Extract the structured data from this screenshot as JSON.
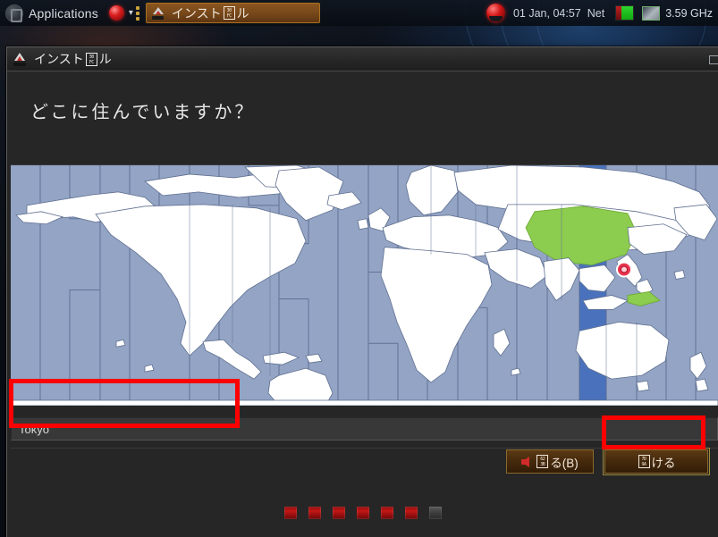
{
  "panel": {
    "applications_label": "Applications",
    "menu_logo_icon": "distro-logo-icon",
    "orb_icon": "red-orb-icon",
    "chevron_icon": "chevron-down-icon",
    "task_button": {
      "icon": "installer-icon",
      "label_prefix": "インスト",
      "tofu_top": "30",
      "tofu_bottom": "FC",
      "label_suffix": "ル"
    },
    "tray": {
      "system_orb_icon": "red-system-orb-icon",
      "clock": "01 Jan, 04:57",
      "network_label": "Net",
      "battery_icon": "battery-icon",
      "cpu_icon": "cpu-monitor-icon",
      "cpu_frequency": "3.59 GHz"
    }
  },
  "window": {
    "icon": "installer-icon",
    "title_prefix": "インスト",
    "title_tofu_top": "30",
    "title_tofu_bottom": "FC",
    "title_suffix": "ル",
    "window_control_icon": "minimize-icon"
  },
  "page": {
    "heading": "どこに住んでいますか？"
  },
  "map": {
    "name": "world-timezone-map",
    "ocean_color": "#93a4c4",
    "land_color": "#ffffff",
    "highlight_color": "#8ccc4e",
    "selected_band_color": "#4a72bc",
    "marker_color": "#e8344e",
    "marker_label": "timezone-marker-tokyo"
  },
  "location": {
    "value": "Tokyo",
    "placeholder": "Tokyo"
  },
  "buttons": {
    "back": {
      "arrow_icon": "arrow-left-icon",
      "tofu_top": "62",
      "tofu_bottom": "3B",
      "label_suffix": "る(B)"
    },
    "continue": {
      "tofu_top": "7D",
      "tofu_bottom": "9A",
      "label_suffix": "ける"
    }
  },
  "progress": {
    "steps": [
      {
        "state": "done"
      },
      {
        "state": "done"
      },
      {
        "state": "done"
      },
      {
        "state": "done"
      },
      {
        "state": "done"
      },
      {
        "state": "done"
      },
      {
        "state": "pending"
      }
    ]
  },
  "annotations": [
    {
      "name": "annotation-location-input",
      "color": "#ff0000"
    },
    {
      "name": "annotation-continue-button",
      "color": "#ff0000"
    }
  ]
}
